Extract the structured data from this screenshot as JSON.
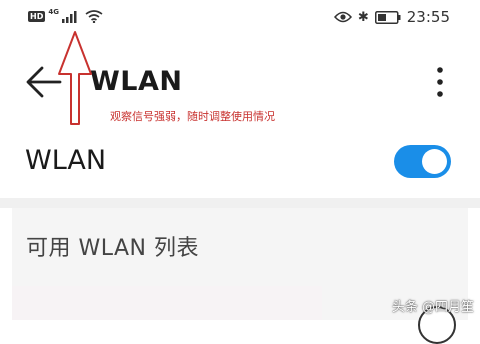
{
  "status_bar": {
    "hd_badge": "HD",
    "network_type": "4G",
    "time": "23:55",
    "icons": [
      "signal-icon",
      "wifi-icon",
      "eye-icon",
      "bluetooth-icon",
      "battery-icon"
    ]
  },
  "header": {
    "title": "WLAN"
  },
  "annotation": {
    "text": "观察信号强弱，随时调整使用情况",
    "color": "#c8322f"
  },
  "wlan_toggle": {
    "label": "WLAN",
    "enabled": true,
    "accent_color": "#1a8ee8"
  },
  "available_list": {
    "title": "可用 WLAN 列表"
  },
  "watermark": {
    "text": "头条 @四月笙"
  }
}
